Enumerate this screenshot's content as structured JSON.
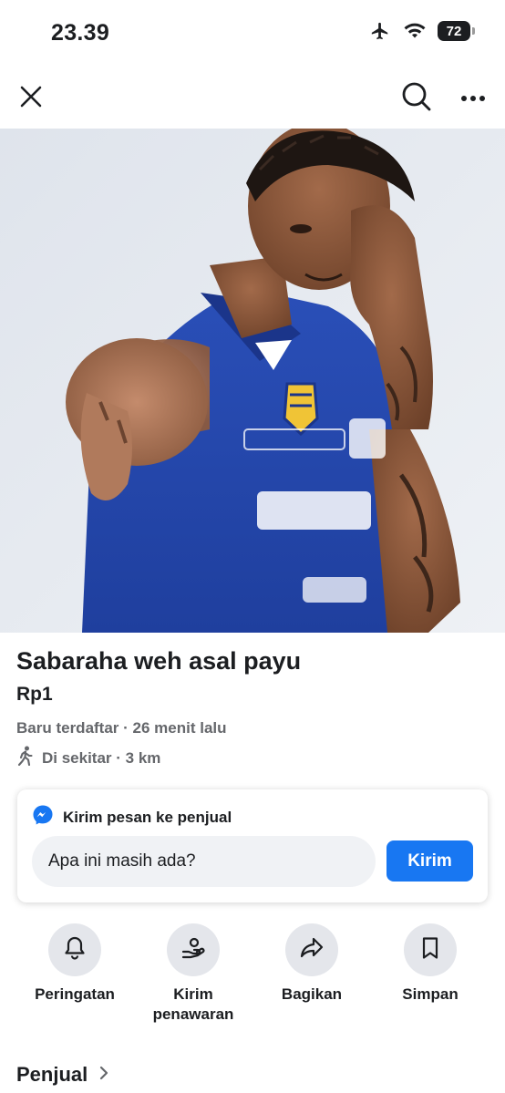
{
  "status_bar": {
    "time": "23.39",
    "battery_level": "72",
    "icons": [
      "airplane-icon",
      "wifi-icon",
      "battery-icon"
    ]
  },
  "nav": {
    "icons": [
      "close-icon",
      "search-icon",
      "more-icon"
    ]
  },
  "listing": {
    "title": "Sabaraha weh asal payu",
    "price": "Rp1",
    "listed": "Baru terdaftar · 26 menit lalu",
    "location": "Di sekitar · 3 km",
    "location_icon": "walking-person-icon"
  },
  "message": {
    "heading": "Kirim pesan ke penjual",
    "heading_icon": "messenger-icon",
    "input_value": "Apa ini masih ada?",
    "send_label": "Kirim"
  },
  "actions": [
    {
      "icon": "bell-icon",
      "label": "Peringatan"
    },
    {
      "icon": "offer-icon",
      "label": "Kirim\npenawaran"
    },
    {
      "icon": "share-icon",
      "label": "Bagikan"
    },
    {
      "icon": "bookmark-icon",
      "label": "Simpan"
    }
  ],
  "seller": {
    "label": "Penjual",
    "icon": "chevron-right-icon"
  },
  "colors": {
    "accent": "#1877f2",
    "secondary_text": "#65676b",
    "circle_bg": "#e4e6eb",
    "input_bg": "#f0f2f5"
  }
}
